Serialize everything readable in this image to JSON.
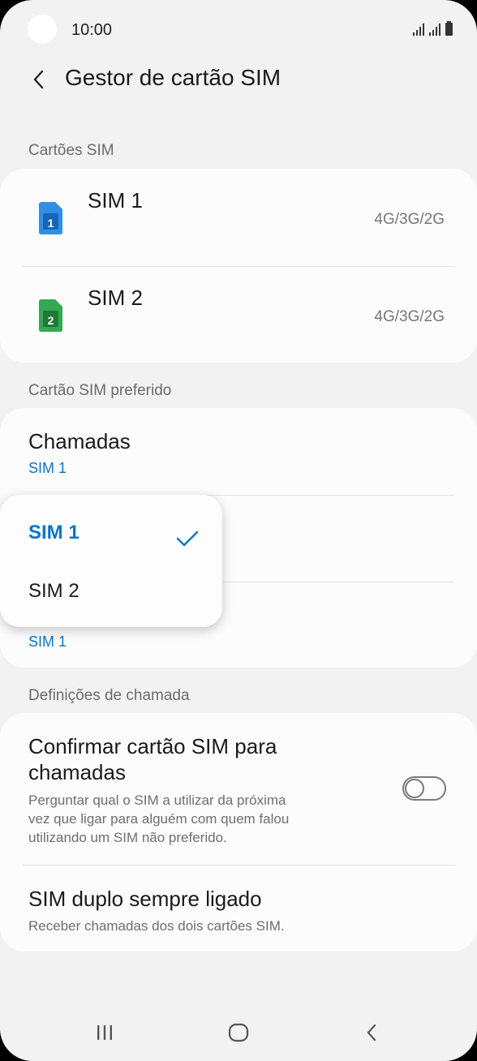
{
  "status_bar": {
    "time": "10:00"
  },
  "header": {
    "title": "Gestor de cartão SIM"
  },
  "sections": {
    "sim_cards": "Cartões SIM",
    "preferred": "Cartão SIM preferido",
    "call_settings": "Definições de chamada"
  },
  "sim_cards": [
    {
      "name": "SIM 1",
      "network": "4G/3G/2G",
      "badge": "1",
      "color": "#2f8ee5"
    },
    {
      "name": "SIM 2",
      "network": "4G/3G/2G",
      "badge": "2",
      "color": "#34a853"
    }
  ],
  "preferred": {
    "calls_title": "Chamadas",
    "calls_value": "SIM 1",
    "data_value": "SIM 1"
  },
  "dropdown": {
    "options": [
      "SIM 1",
      "SIM 2"
    ],
    "selected": "SIM 1",
    "accent_color": "#0a74c9"
  },
  "call_settings": {
    "confirm_title_line1": "Confirmar cartão SIM para",
    "confirm_title_line2": "chamadas",
    "confirm_desc_line1": "Perguntar qual o SIM a utilizar da próxima",
    "confirm_desc_line2": "vez que ligar para alguém com quem falou",
    "confirm_desc_line3": "utilizando um SIM não preferido.",
    "confirm_enabled": false,
    "dual_title": "SIM duplo sempre ligado",
    "dual_desc": "Receber chamadas dos dois cartões SIM."
  },
  "icons": {
    "back": "chevron-left-icon",
    "check": "check-icon",
    "nav_recent": "recent-apps-icon",
    "nav_home": "home-icon",
    "nav_back": "back-icon"
  }
}
